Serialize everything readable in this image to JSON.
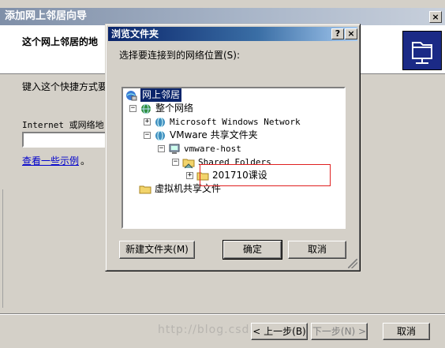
{
  "wizard": {
    "title": "添加网上邻居向导",
    "close_glyph": "×",
    "header_title": "这个网上邻居的地",
    "prompt": "键入这个快捷方式要",
    "address_label": "Internet 或网络地",
    "address_value": "",
    "examples_link": "查看一些示例",
    "examples_suffix": "。",
    "back_button": "< 上一步(B)",
    "next_button": "下一步(N) >",
    "cancel_button": "取消",
    "watermark": "http://blog.csdn.net/"
  },
  "dialog": {
    "title": "浏览文件夹",
    "help_glyph": "?",
    "close_glyph": "×",
    "instruction": "选择要连接到的网络位置(S):",
    "tree": {
      "network_places": "网上邻居",
      "entire_network": "整个网络",
      "ms_windows_network": "Microsoft Windows Network",
      "vmware_shared": "VMware 共享文件夹",
      "vmware_host": "vmware-host",
      "shared_folders": "Shared Folders",
      "course_folder": "201710课设",
      "vm_shared_files": "虚拟机共享文件"
    },
    "expander_plus": "+",
    "expander_minus": "−",
    "new_folder_button": "新建文件夹(M)",
    "ok_button": "确定",
    "cancel_button": "取消"
  },
  "colors": {
    "selection": "#0a246a",
    "highlight_box": "#e02020",
    "link": "#0000cc"
  }
}
